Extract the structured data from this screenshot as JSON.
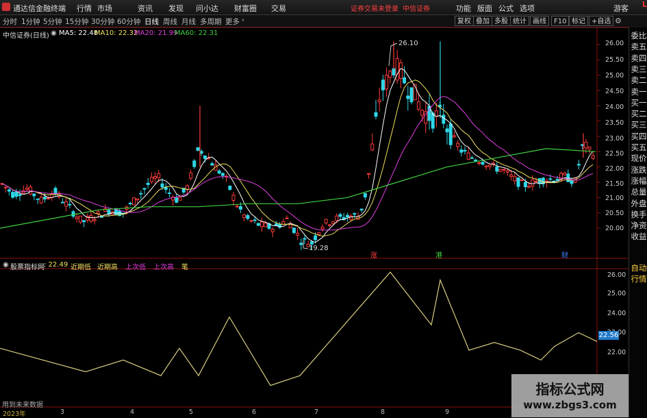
{
  "app": {
    "title": "通达信金融终端"
  },
  "menu": [
    "行情",
    "市场",
    "资讯",
    "发现",
    "问小达",
    "财富圈",
    "交易"
  ],
  "login_warning": "证券交易未登录",
  "broker": "中信证券",
  "right_menu": [
    "功能",
    "版面",
    "公式",
    "选项"
  ],
  "guest": "游客",
  "periods": [
    "分时",
    "1分钟",
    "5分钟",
    "15分钟",
    "30分钟",
    "60分钟",
    "日线",
    "周线",
    "月线",
    "多周期",
    "更多"
  ],
  "active_period": "日线",
  "tool_buttons": [
    "复权",
    "叠加",
    "多股",
    "统计",
    "画线",
    "F10",
    "标记",
    "+自选"
  ],
  "right_panel": {
    "marker": "L",
    "items": [
      "委比",
      "卖五",
      "卖四",
      "卖三",
      "卖二",
      "卖一",
      "买一",
      "买二",
      "买三",
      "买四",
      "买五",
      "现价",
      "涨跌",
      "涨幅",
      "总量",
      "外盘",
      "换手",
      "净资",
      "收益",
      "自动",
      "行情"
    ]
  },
  "main_chart": {
    "stock": "中信证券(日线)",
    "ma": [
      {
        "label": "MA5: 22.48",
        "color": "#ffffff"
      },
      {
        "label": "MA10: 22.32",
        "color": "#f0e060"
      },
      {
        "label": "MA20: 21.99",
        "color": "#e040e0"
      },
      {
        "label": "MA60: 22.31",
        "color": "#40d040"
      }
    ],
    "high_label": "26.10",
    "low_label": "19.28",
    "markers": [
      {
        "text": "涨",
        "color": "#ff4040"
      },
      {
        "text": "港",
        "color": "#40d040"
      },
      {
        "text": "财",
        "color": "#4080ff"
      }
    ],
    "y_ticks": [
      "26.00",
      "25.50",
      "25.00",
      "24.50",
      "24.00",
      "23.50",
      "23.00",
      "22.50",
      "22.00",
      "21.50",
      "21.00",
      "20.50",
      "20.00"
    ]
  },
  "indicator": {
    "name": "股票指标网",
    "value": ": 22.49",
    "lines": [
      {
        "label": "近期低",
        "color": "#f0e060"
      },
      {
        "label": "近期高",
        "color": "#f0e060"
      },
      {
        "label": "上次低",
        "color": "#e040e0"
      },
      {
        "label": "上次高",
        "color": "#e040e0"
      },
      {
        "label": "笔",
        "color": "#f0e060"
      }
    ],
    "y_ticks": [
      "26.00",
      "25.00",
      "24.00",
      "23.00",
      "22.00"
    ],
    "current_tag": "22.56",
    "note": "用到未来数据"
  },
  "x_axis": [
    "2023年",
    "3",
    "4",
    "5",
    "6",
    "7",
    "8",
    "9"
  ],
  "watermark": {
    "title": "指标公式网",
    "url": "www.zbgs3.com"
  },
  "colors": {
    "up": "#ff3c3c",
    "down": "#2fd6e6",
    "ma5": "#ffffff",
    "ma10": "#f0e060",
    "ma20": "#e040e0",
    "ma60": "#40d040",
    "zigzag": "#d8cc80"
  },
  "chart_data": {
    "type": "line",
    "title": "中信证券(日线)",
    "series": [
      {
        "name": "MA60",
        "values": [
          20.0,
          20.3,
          20.6,
          20.7,
          20.7,
          20.8,
          20.8,
          21.0,
          21.5,
          22.0,
          22.3,
          22.6,
          22.5
        ]
      },
      {
        "name": "笔",
        "values": [
          22.2,
          21.0,
          21.6,
          20.8,
          22.2,
          20.8,
          23.8,
          20.3,
          26.1,
          23.4,
          25.7,
          22.1,
          22.5
        ]
      }
    ],
    "x": [
      "2023年",
      "3",
      "4",
      "5",
      "6",
      "7",
      "8",
      "9"
    ],
    "ylim": [
      19.0,
      26.5
    ]
  }
}
